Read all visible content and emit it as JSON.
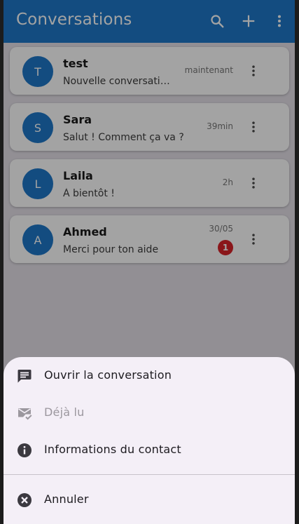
{
  "app_bar": {
    "title": "Conversations",
    "color": "#1e78c8",
    "actions": [
      "search-icon",
      "add-icon",
      "more-vert-icon"
    ]
  },
  "conversations": [
    {
      "initial": "T",
      "name": "test",
      "last_message": "Nouvelle conversati…",
      "time": "maintenant",
      "unread": ""
    },
    {
      "initial": "S",
      "name": "Sara",
      "last_message": "Salut ! Comment ça va ?",
      "time": "39min",
      "unread": ""
    },
    {
      "initial": "L",
      "name": "Laila",
      "last_message": "À bientôt !",
      "time": "2h",
      "unread": ""
    },
    {
      "initial": "A",
      "name": "Ahmed",
      "last_message": "Merci pour ton aide",
      "time": "30/05",
      "unread": "1"
    }
  ],
  "bottom_sheet": {
    "items": [
      {
        "label": "Ouvrir la conversation",
        "icon": "chat-icon",
        "enabled": true
      },
      {
        "label": "Déjà lu",
        "icon": "mark-read-icon",
        "enabled": false
      },
      {
        "label": "Informations du contact",
        "icon": "info-icon",
        "enabled": true
      },
      {
        "label": "Annuler",
        "icon": "cancel-icon",
        "enabled": true
      }
    ]
  },
  "colors": {
    "accent": "#1e78c8",
    "badge": "#d8232a",
    "sheet_background": "#f4eff7"
  }
}
